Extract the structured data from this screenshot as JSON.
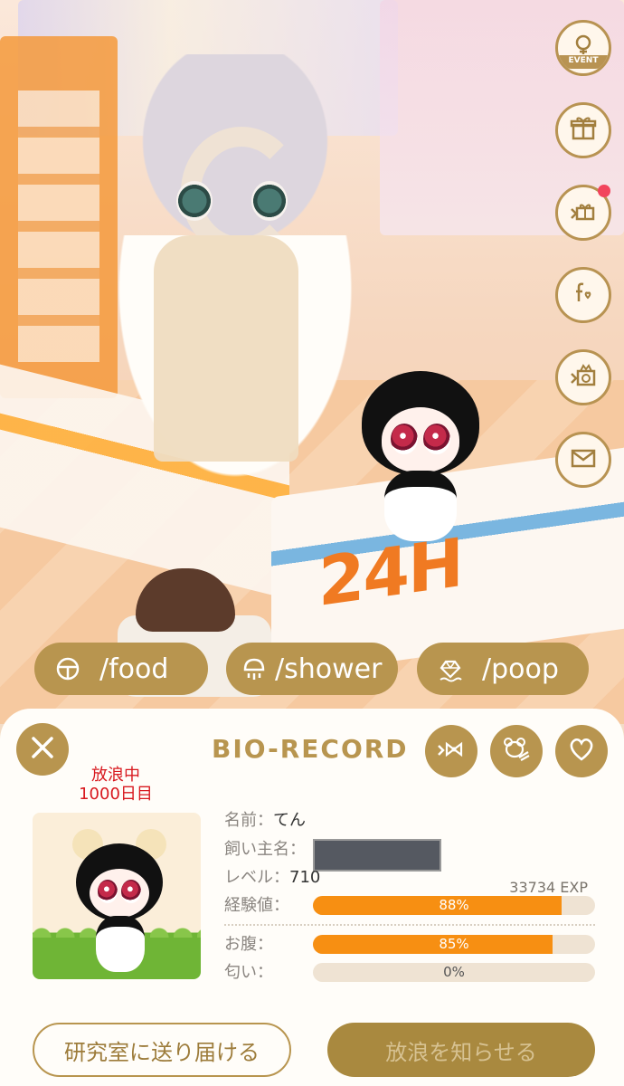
{
  "scene": {
    "sign_text": "24H"
  },
  "rail": {
    "event_label": "EVENT",
    "items": [
      {
        "icon": "event-icon"
      },
      {
        "icon": "gift-box-icon"
      },
      {
        "icon": "bundle-gift-icon",
        "badge": true
      },
      {
        "icon": "friends-icon"
      },
      {
        "icon": "gacha-icon"
      },
      {
        "icon": "mail-icon"
      }
    ]
  },
  "commands": [
    {
      "label": "/food",
      "icon": "food-icon"
    },
    {
      "label": "/shower",
      "icon": "shower-icon"
    },
    {
      "label": "/poop",
      "icon": "poop-icon"
    }
  ],
  "panel": {
    "title": "BIO-RECORD",
    "status_line1": "放浪中",
    "status_line2": "1000日目",
    "name_label": "名前：",
    "name_value": "てん",
    "owner_label": "飼い主名：",
    "level_label": "レベル：",
    "level_value": "710",
    "exp_total": "33734 EXP",
    "exp_label": "経験値：",
    "exp_pct": "88%",
    "exp_value": 0.88,
    "hunger_label": "お腹：",
    "hunger_pct": "85%",
    "hunger_value": 0.85,
    "smell_label": "匂い：",
    "smell_pct": "0%",
    "smell_value": 0,
    "send_lab_button": "研究室に送り届ける",
    "notify_button": "放浪を知らせる"
  },
  "colors": {
    "gold": "#b8954f",
    "bar_fill": "#f78f12",
    "status_red": "#d8191f"
  }
}
